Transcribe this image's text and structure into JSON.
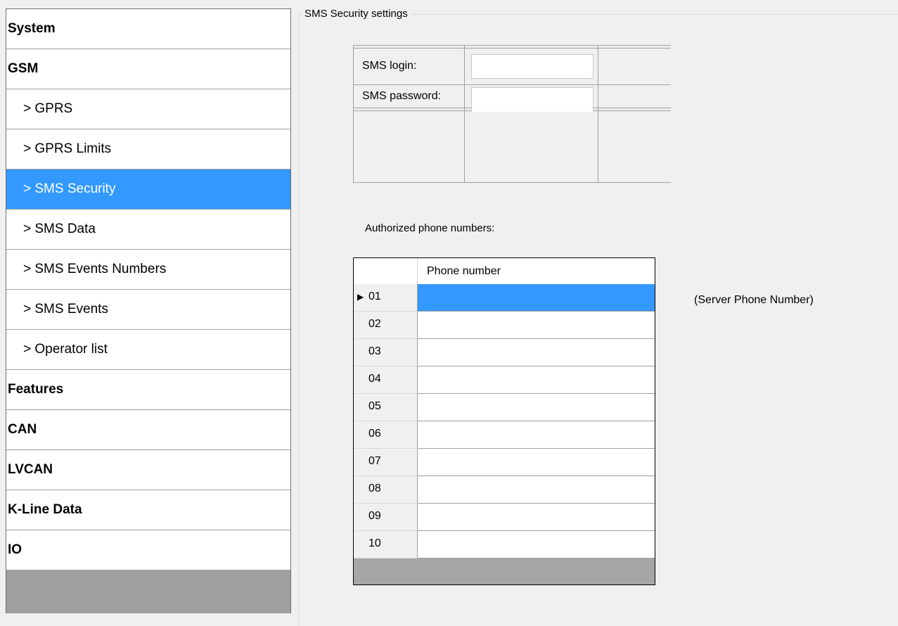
{
  "sidebar": {
    "items": [
      {
        "label": "System",
        "level": "top"
      },
      {
        "label": "GSM",
        "level": "top"
      },
      {
        "label": "> GPRS",
        "level": "sub"
      },
      {
        "label": "> GPRS Limits",
        "level": "sub"
      },
      {
        "label": "> SMS Security",
        "level": "sub",
        "selected": true
      },
      {
        "label": "> SMS Data",
        "level": "sub"
      },
      {
        "label": "> SMS Events Numbers",
        "level": "sub"
      },
      {
        "label": "> SMS Events",
        "level": "sub"
      },
      {
        "label": "> Operator list",
        "level": "sub"
      },
      {
        "label": "Features",
        "level": "top"
      },
      {
        "label": "CAN",
        "level": "top"
      },
      {
        "label": "LVCAN",
        "level": "top"
      },
      {
        "label": "K-Line Data",
        "level": "top"
      },
      {
        "label": "IO",
        "level": "top"
      }
    ]
  },
  "settings": {
    "group_title": "SMS Security settings",
    "login_label": "SMS login:",
    "login_value": "",
    "password_label": "SMS password:",
    "password_value": ""
  },
  "authorized": {
    "label": "Authorized phone numbers:",
    "column_header": "Phone number",
    "rows": [
      {
        "index": "01",
        "value": "",
        "selected": true
      },
      {
        "index": "02",
        "value": ""
      },
      {
        "index": "03",
        "value": ""
      },
      {
        "index": "04",
        "value": ""
      },
      {
        "index": "05",
        "value": ""
      },
      {
        "index": "06",
        "value": ""
      },
      {
        "index": "07",
        "value": ""
      },
      {
        "index": "08",
        "value": ""
      },
      {
        "index": "09",
        "value": ""
      },
      {
        "index": "10",
        "value": ""
      }
    ],
    "server_note": "(Server Phone Number)"
  },
  "colors": {
    "selection": "#3399ff",
    "background": "#f0f0f0",
    "sidebar_empty": "#a0a0a0"
  }
}
